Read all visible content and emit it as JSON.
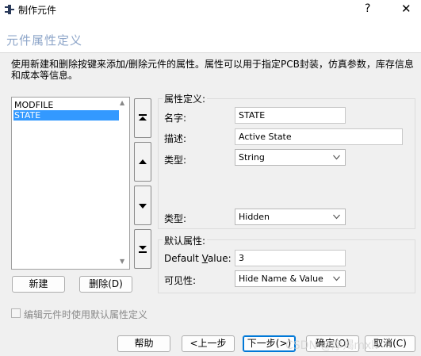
{
  "window": {
    "title": "制作元件",
    "help_glyph": "?",
    "close_glyph": "✕"
  },
  "header": {
    "title": "元件属性定义"
  },
  "description": "使用新建和删除按键来添加/删除元件的属性。属性可以用于指定PCB封装，仿真参数，库存信息和成本等信息。",
  "attributes_list": {
    "items": [
      {
        "label": "MODFILE",
        "selected": false
      },
      {
        "label": "STATE",
        "selected": true
      }
    ]
  },
  "list_buttons": {
    "new_label": "新建",
    "delete_label": "删除(D)"
  },
  "attribute_definition": {
    "group_label": "属性定义:",
    "name_label": "名字:",
    "name_value": "STATE",
    "desc_label": "描述:",
    "desc_value": "Active State",
    "type_label": "类型:",
    "type_value": "String",
    "type2_label": "类型:",
    "type2_value": "Hidden"
  },
  "default_attribute": {
    "group_label": "默认属性:",
    "default_value_label": "Default Value:",
    "default_value": "3",
    "visibility_label": "可见性:",
    "visibility_value": "Hide Name & Value"
  },
  "checkbox": {
    "label": "编辑元件时使用默认属性定义",
    "checked": false
  },
  "footer": {
    "help_label": "帮助",
    "back_label": "<上一步",
    "next_label": "下一步(>)",
    "finish_label": "确定(O)",
    "cancel_label": "取消(C)"
  },
  "watermark": "CSDN @摩羯mxk"
}
